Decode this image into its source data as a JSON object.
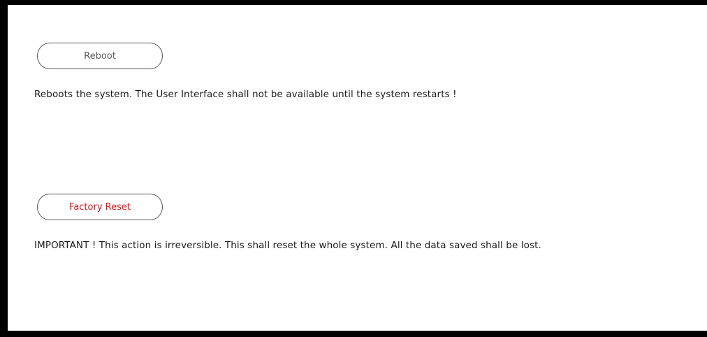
{
  "reboot": {
    "button_label": "Reboot",
    "description": "Reboots the system. The User Interface shall not be available until the system restarts !"
  },
  "factory_reset": {
    "button_label": "Factory Reset",
    "description": "IMPORTANT ! This action is irreversible. This shall reset the whole system. All the data saved shall be lost."
  },
  "colors": {
    "danger": "#e8131b",
    "button_text": "#5a5a5a",
    "frame": "#000000"
  }
}
